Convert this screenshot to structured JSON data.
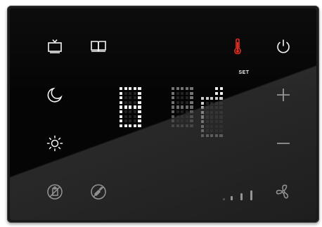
{
  "panel": {
    "set_label": "SET",
    "accent_color": "#e0271b",
    "icon_color": "#f5f5f5"
  },
  "icons": {
    "tv": "tv-icon",
    "book": "book-icon",
    "thermometer": "thermometer-icon",
    "power": "power-icon",
    "moon": "moon-icon",
    "plus": "plus-icon",
    "sun": "sun-icon",
    "minus": "minus-icon",
    "no_disturb": "no-disturb-icon",
    "no_cleaning": "no-cleaning-icon",
    "fan": "fan-icon"
  },
  "fan_speed_level": 0.75
}
